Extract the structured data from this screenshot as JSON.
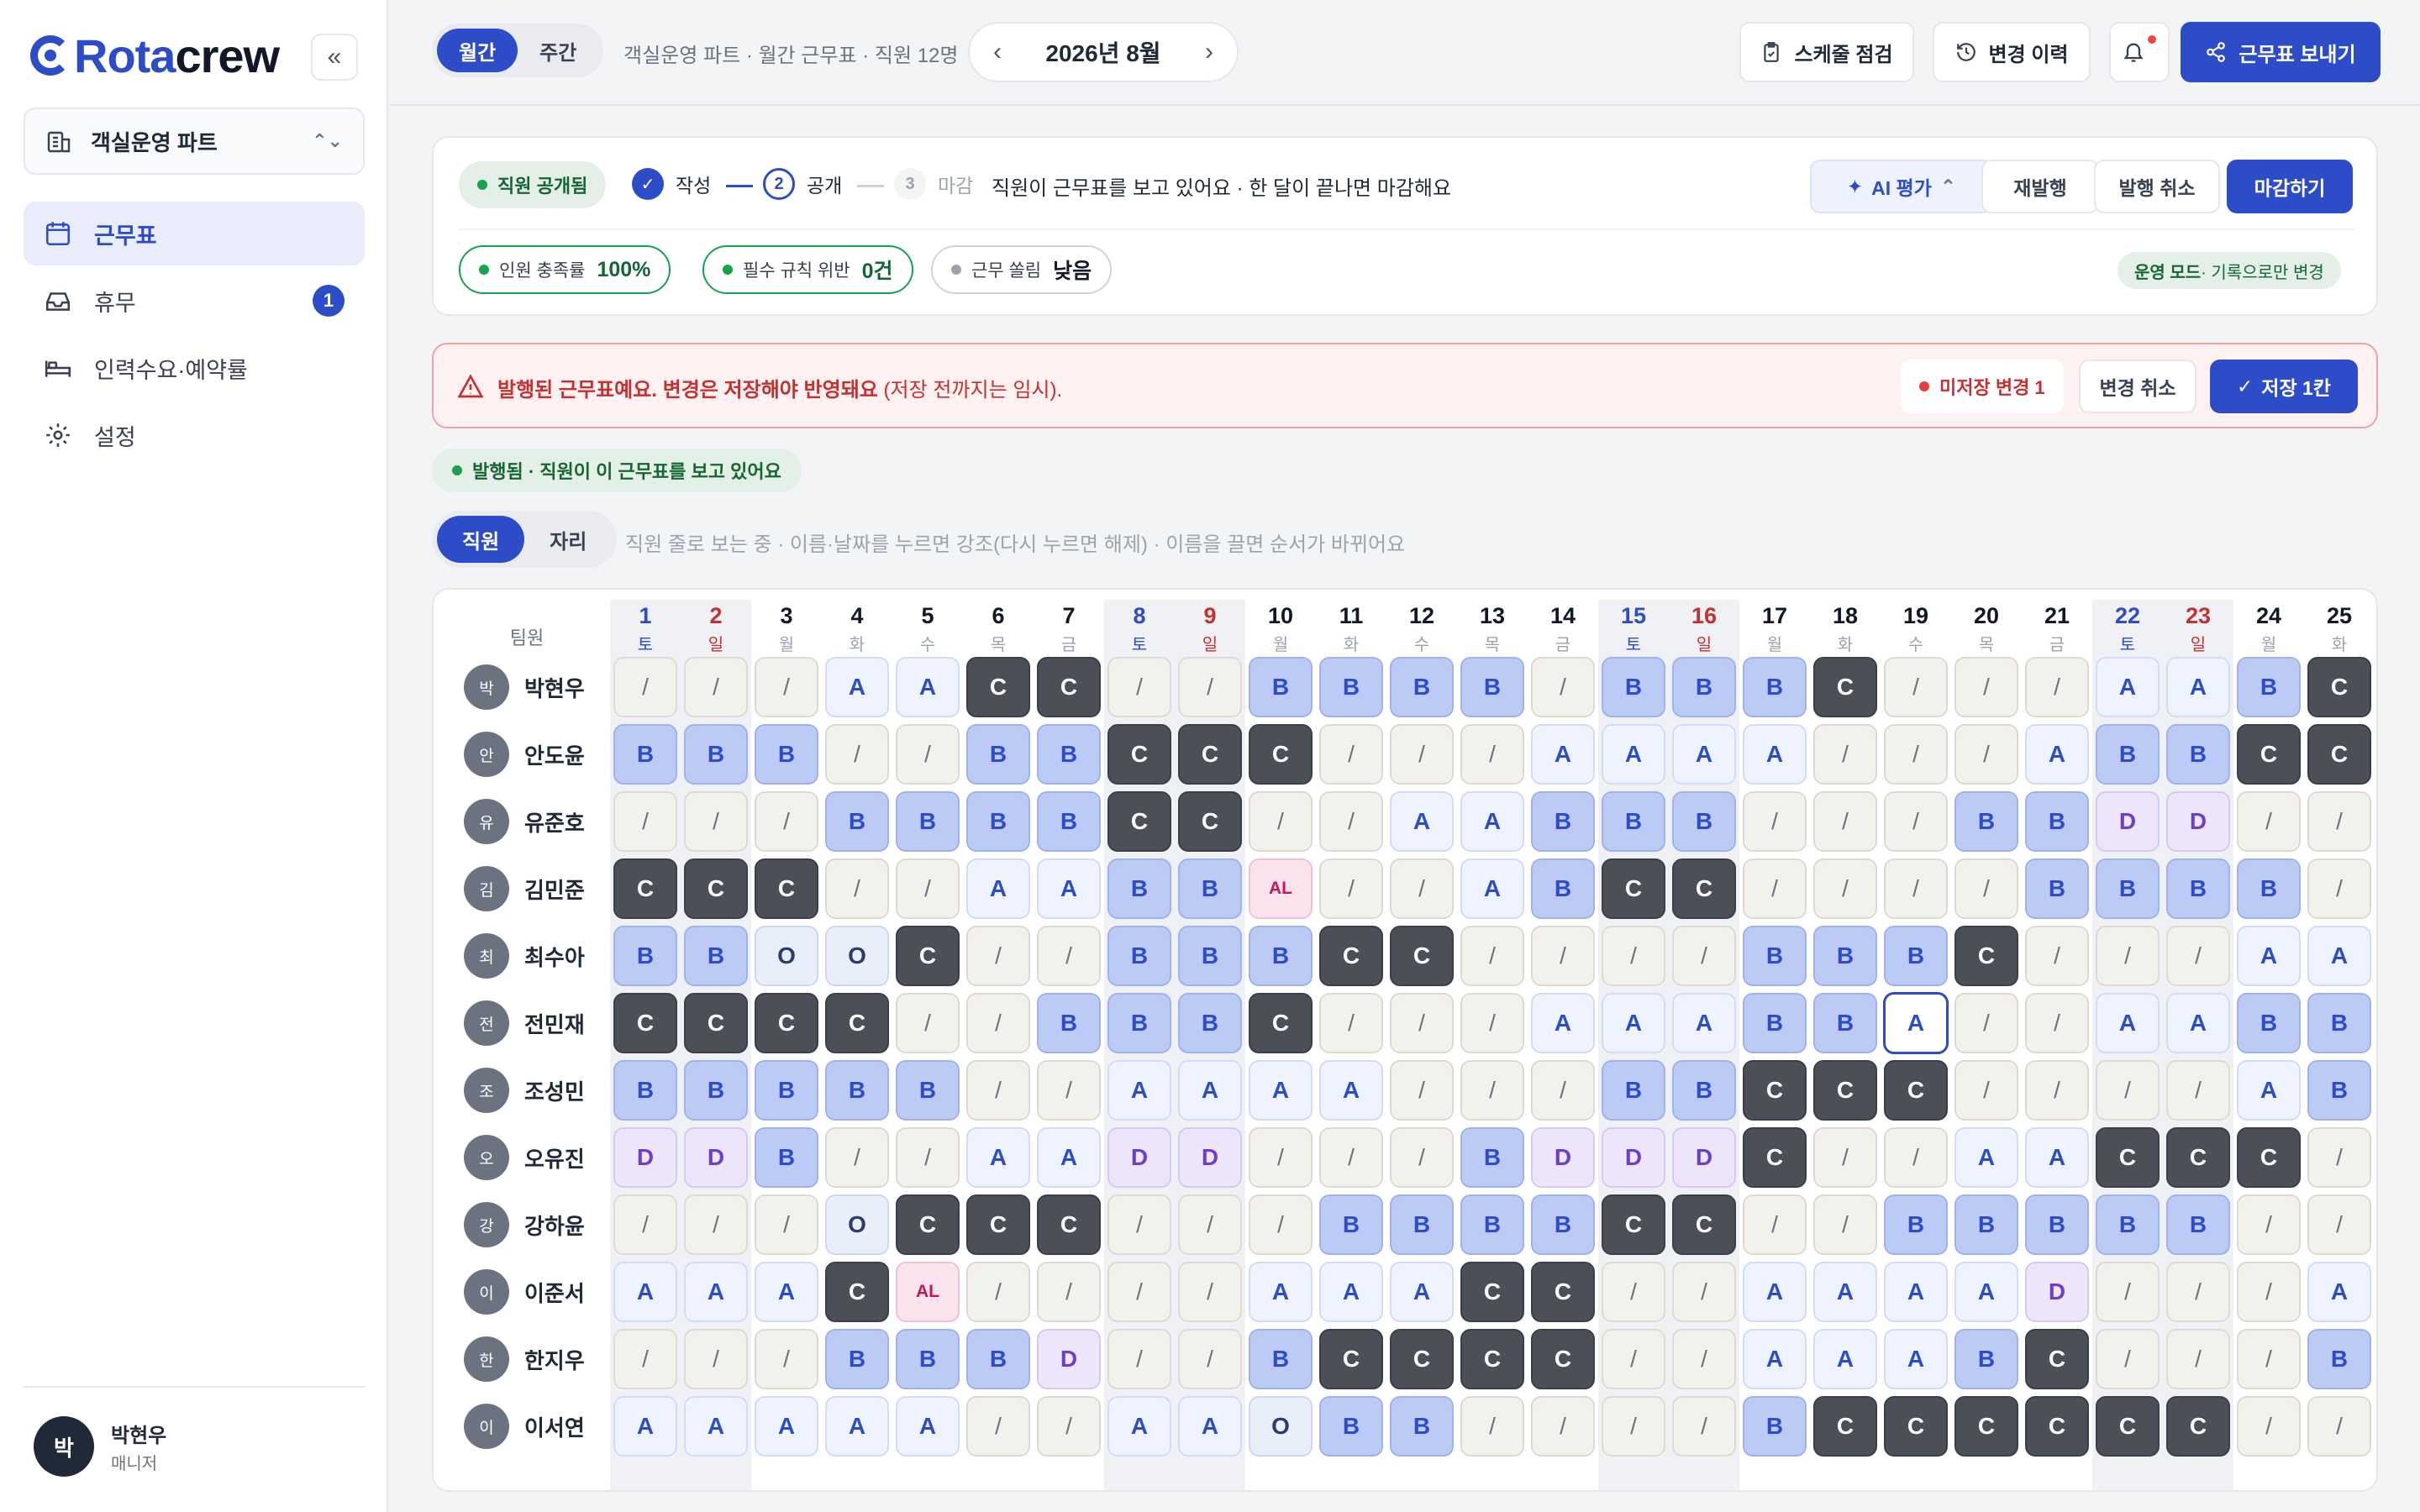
{
  "app": {
    "logo_a": "Rota",
    "logo_b": "crew",
    "team": "객실운영 파트"
  },
  "nav": [
    {
      "label": "근무표"
    },
    {
      "label": "휴무",
      "badge": "1"
    },
    {
      "label": "인력수요·예약률"
    },
    {
      "label": "설정"
    }
  ],
  "user": {
    "initial": "박",
    "name": "박현우",
    "role": "매니저"
  },
  "topbar": {
    "tab_month": "월간",
    "tab_week": "주간",
    "crumb": "객실운영 파트 · 월간 근무표 · 직원 12명",
    "month": "2026년 8월",
    "check": "스케줄 점검",
    "history": "변경 이력",
    "send": "근무표 보내기"
  },
  "status": {
    "badge": "직원 공개됨",
    "step1": "작성",
    "step2_num": "2",
    "step2": "공개",
    "step3_num": "3",
    "step3": "마감",
    "desc": "직원이 근무표를 보고 있어요 · 한 달이 끝나면 마감해요",
    "ai": "AI 평가",
    "reissue": "재발행",
    "cancel_issue": "발행 취소",
    "close": "마감하기"
  },
  "metrics": [
    {
      "label": "인원 충족률",
      "value": "100%"
    },
    {
      "label": "필수 규칙 위반",
      "value": "0건"
    },
    {
      "label": "근무 쏠림",
      "value": "낮음"
    }
  ],
  "mode": {
    "label": "운영 모드",
    "desc": " · 기록으로만 변경"
  },
  "alert": {
    "text": "발행된 근무표예요. 변경은 저장해야 반영돼요",
    "sub": " (저장 전까지는 임시).",
    "unsaved": "미저장 변경 1",
    "undo": "변경 취소",
    "save": "저장 1칸"
  },
  "published": "발행됨 · 직원이 이 근무표를 보고 있어요",
  "view": {
    "staff": "직원",
    "seat": "자리",
    "hint": "직원 줄로 보는 중 · 이름·날짜를 누르면 강조(다시 누르면 해제) · 이름을 끌면 순서가 바뀌어요"
  },
  "grid": {
    "header_label": "팀원",
    "days": [
      {
        "n": "1",
        "w": "토"
      },
      {
        "n": "2",
        "w": "일"
      },
      {
        "n": "3",
        "w": "월"
      },
      {
        "n": "4",
        "w": "화"
      },
      {
        "n": "5",
        "w": "수"
      },
      {
        "n": "6",
        "w": "목"
      },
      {
        "n": "7",
        "w": "금"
      },
      {
        "n": "8",
        "w": "토"
      },
      {
        "n": "9",
        "w": "일"
      },
      {
        "n": "10",
        "w": "월"
      },
      {
        "n": "11",
        "w": "화"
      },
      {
        "n": "12",
        "w": "수"
      },
      {
        "n": "13",
        "w": "목"
      },
      {
        "n": "14",
        "w": "금"
      },
      {
        "n": "15",
        "w": "토"
      },
      {
        "n": "16",
        "w": "일"
      },
      {
        "n": "17",
        "w": "월"
      },
      {
        "n": "18",
        "w": "화"
      },
      {
        "n": "19",
        "w": "수"
      },
      {
        "n": "20",
        "w": "목"
      },
      {
        "n": "21",
        "w": "금"
      },
      {
        "n": "22",
        "w": "토"
      },
      {
        "n": "23",
        "w": "일"
      },
      {
        "n": "24",
        "w": "월"
      },
      {
        "n": "25",
        "w": "화"
      }
    ],
    "rows": [
      {
        "initial": "박",
        "name": "박현우",
        "shifts": [
          "/",
          "/",
          "/",
          "A",
          "A",
          "C",
          "C",
          "/",
          "/",
          "B",
          "B",
          "B",
          "B",
          "/",
          "B",
          "B",
          "B",
          "C",
          "/",
          "/",
          "/",
          "A",
          "A",
          "B",
          "C"
        ]
      },
      {
        "initial": "안",
        "name": "안도윤",
        "shifts": [
          "B",
          "B",
          "B",
          "/",
          "/",
          "B",
          "B",
          "C",
          "C",
          "C",
          "/",
          "/",
          "/",
          "A",
          "A",
          "A",
          "A",
          "/",
          "/",
          "/",
          "A",
          "B",
          "B",
          "C",
          "C"
        ]
      },
      {
        "initial": "유",
        "name": "유준호",
        "shifts": [
          "/",
          "/",
          "/",
          "B",
          "B",
          "B",
          "B",
          "C",
          "C",
          "/",
          "/",
          "A",
          "A",
          "B",
          "B",
          "B",
          "/",
          "/",
          "/",
          "B",
          "B",
          "D",
          "D",
          "/",
          "/"
        ]
      },
      {
        "initial": "김",
        "name": "김민준",
        "shifts": [
          "C",
          "C",
          "C",
          "/",
          "/",
          "A",
          "A",
          "B",
          "B",
          "AL",
          "/",
          "/",
          "A",
          "B",
          "C",
          "C",
          "/",
          "/",
          "/",
          "/",
          "B",
          "B",
          "B",
          "B",
          "/"
        ]
      },
      {
        "initial": "최",
        "name": "최수아",
        "shifts": [
          "B",
          "B",
          "O",
          "O",
          "C",
          "/",
          "/",
          "B",
          "B",
          "B",
          "C",
          "C",
          "/",
          "/",
          "/",
          "/",
          "B",
          "B",
          "B",
          "C",
          "/",
          "/",
          "/",
          "A",
          "A"
        ]
      },
      {
        "initial": "전",
        "name": "전민재",
        "shifts": [
          "C",
          "C",
          "C",
          "C",
          "/",
          "/",
          "B",
          "B",
          "B",
          "C",
          "/",
          "/",
          "/",
          "A",
          "A",
          "A",
          "B",
          "B",
          "A",
          "/",
          "/",
          "A",
          "A",
          "B",
          "B"
        ]
      },
      {
        "initial": "조",
        "name": "조성민",
        "shifts": [
          "B",
          "B",
          "B",
          "B",
          "B",
          "/",
          "/",
          "A",
          "A",
          "A",
          "A",
          "/",
          "/",
          "/",
          "B",
          "B",
          "C",
          "C",
          "C",
          "/",
          "/",
          "/",
          "/",
          "A",
          "B"
        ]
      },
      {
        "initial": "오",
        "name": "오유진",
        "shifts": [
          "D",
          "D",
          "B",
          "/",
          "/",
          "A",
          "A",
          "D",
          "D",
          "/",
          "/",
          "/",
          "B",
          "D",
          "D",
          "D",
          "C",
          "/",
          "/",
          "A",
          "A",
          "C",
          "C",
          "C",
          "/"
        ]
      },
      {
        "initial": "강",
        "name": "강하윤",
        "shifts": [
          "/",
          "/",
          "/",
          "O",
          "C",
          "C",
          "C",
          "/",
          "/",
          "/",
          "B",
          "B",
          "B",
          "B",
          "C",
          "C",
          "/",
          "/",
          "B",
          "B",
          "B",
          "B",
          "B",
          "/",
          "/"
        ]
      },
      {
        "initial": "이",
        "name": "이준서",
        "shifts": [
          "A",
          "A",
          "A",
          "C",
          "AL",
          "/",
          "/",
          "/",
          "/",
          "A",
          "A",
          "A",
          "C",
          "C",
          "/",
          "/",
          "A",
          "A",
          "A",
          "A",
          "D",
          "/",
          "/",
          "/",
          "A"
        ]
      },
      {
        "initial": "한",
        "name": "한지우",
        "shifts": [
          "/",
          "/",
          "/",
          "B",
          "B",
          "B",
          "D",
          "/",
          "/",
          "B",
          "C",
          "C",
          "C",
          "C",
          "/",
          "/",
          "A",
          "A",
          "A",
          "B",
          "C",
          "/",
          "/",
          "/",
          "B"
        ]
      },
      {
        "initial": "이",
        "name": "이서연",
        "shifts": [
          "A",
          "A",
          "A",
          "A",
          "A",
          "/",
          "/",
          "A",
          "A",
          "O",
          "B",
          "B",
          "/",
          "/",
          "/",
          "/",
          "B",
          "C",
          "C",
          "C",
          "C",
          "C",
          "C",
          "/",
          "/"
        ]
      }
    ]
  }
}
